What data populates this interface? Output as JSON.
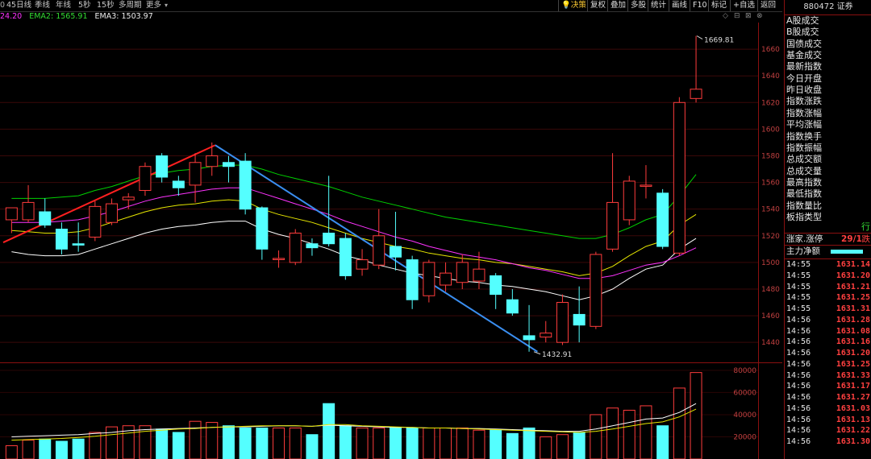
{
  "toolbar": {
    "tabs": [
      "0",
      "45日线",
      "季线",
      "年线",
      "5秒",
      "15秒",
      "多周期",
      "更多"
    ],
    "indicators": {
      "ema1": "24.20",
      "ema2": "EMA2: 1565.91",
      "ema3": "EMA3: 1503.97"
    },
    "tools": [
      "决策",
      "复权",
      "叠加",
      "多股",
      "统计",
      "画线",
      "F10",
      "标记",
      "+自选",
      "返回"
    ]
  },
  "chart": {
    "y_labels": [
      "1660",
      "1640",
      "1620",
      "1600",
      "1580",
      "1560",
      "1540",
      "1520",
      "1500",
      "1480",
      "1460",
      "1440"
    ],
    "high_label": "1669.81",
    "low_label": "1432.91",
    "vol_labels": [
      "80000",
      "60000",
      "40000",
      "20000"
    ],
    "colors": {
      "up": "#ff3c3c",
      "down": "#54ffff",
      "ma1": "#ffffff",
      "ma2": "#e6e600",
      "ma3": "#ff33ff",
      "ma4": "#00d200",
      "trend_up": "#ff2020",
      "trend_down": "#3a8ef0"
    }
  },
  "sidebar": {
    "code": "880472",
    "name": "证券",
    "menu": [
      "A股成交",
      "B股成交",
      "国债成交",
      "基金成交",
      "最新指数",
      "今日开盘",
      "昨日收盘",
      "指数涨跌",
      "指数涨幅",
      "平均涨幅",
      "指数换手",
      "指数振幅",
      "总成交额",
      "总成交量",
      "最高指数",
      "最低指数",
      "指数量比",
      "板指类型"
    ],
    "board_type_value": "行",
    "limit_label": "涨家.涨停",
    "limit_value": "29/1",
    "limit_suffix": "跌",
    "net_flow_label": "主力净额",
    "ticks": [
      {
        "time": "14:55",
        "price": "1631.14"
      },
      {
        "time": "14:55",
        "price": "1631.20"
      },
      {
        "time": "14:55",
        "price": "1631.21"
      },
      {
        "time": "14:55",
        "price": "1631.25"
      },
      {
        "time": "14:55",
        "price": "1631.31"
      },
      {
        "time": "14:56",
        "price": "1631.28"
      },
      {
        "time": "14:56",
        "price": "1631.08"
      },
      {
        "time": "14:56",
        "price": "1631.16"
      },
      {
        "time": "14:56",
        "price": "1631.20"
      },
      {
        "time": "14:56",
        "price": "1631.25"
      },
      {
        "time": "14:56",
        "price": "1631.33"
      },
      {
        "time": "14:56",
        "price": "1631.17"
      },
      {
        "time": "14:56",
        "price": "1631.27"
      },
      {
        "time": "14:56",
        "price": "1631.03"
      },
      {
        "time": "14:56",
        "price": "1631.13"
      },
      {
        "time": "14:56",
        "price": "1631.22"
      },
      {
        "time": "14:56",
        "price": "1631.30"
      }
    ]
  },
  "chart_data": {
    "type": "candlestick",
    "candles": [
      {
        "o": 1532,
        "h": 1540,
        "l": 1522,
        "c": 1541
      },
      {
        "o": 1532,
        "h": 1558,
        "l": 1530,
        "c": 1545
      },
      {
        "o": 1538,
        "h": 1548,
        "l": 1526,
        "c": 1528
      },
      {
        "o": 1525,
        "h": 1530,
        "l": 1506,
        "c": 1510
      },
      {
        "o": 1514,
        "h": 1530,
        "l": 1508,
        "c": 1513
      },
      {
        "o": 1519,
        "h": 1546,
        "l": 1516,
        "c": 1542
      },
      {
        "o": 1530,
        "h": 1548,
        "l": 1528,
        "c": 1544
      },
      {
        "o": 1547,
        "h": 1552,
        "l": 1540,
        "c": 1549
      },
      {
        "o": 1554,
        "h": 1575,
        "l": 1550,
        "c": 1572
      },
      {
        "o": 1580,
        "h": 1582,
        "l": 1560,
        "c": 1564
      },
      {
        "o": 1561,
        "h": 1565,
        "l": 1550,
        "c": 1556
      },
      {
        "o": 1558,
        "h": 1582,
        "l": 1545,
        "c": 1575
      },
      {
        "o": 1572,
        "h": 1590,
        "l": 1565,
        "c": 1580
      },
      {
        "o": 1575,
        "h": 1580,
        "l": 1560,
        "c": 1572
      },
      {
        "o": 1576,
        "h": 1582,
        "l": 1536,
        "c": 1540
      },
      {
        "o": 1541,
        "h": 1542,
        "l": 1502,
        "c": 1510
      },
      {
        "o": 1503,
        "h": 1509,
        "l": 1496,
        "c": 1503
      },
      {
        "o": 1500,
        "h": 1525,
        "l": 1498,
        "c": 1522
      },
      {
        "o": 1514,
        "h": 1518,
        "l": 1505,
        "c": 1511
      },
      {
        "o": 1522,
        "h": 1565,
        "l": 1512,
        "c": 1514
      },
      {
        "o": 1518,
        "h": 1522,
        "l": 1487,
        "c": 1490
      },
      {
        "o": 1495,
        "h": 1510,
        "l": 1490,
        "c": 1502
      },
      {
        "o": 1498,
        "h": 1540,
        "l": 1495,
        "c": 1520
      },
      {
        "o": 1512,
        "h": 1538,
        "l": 1494,
        "c": 1504
      },
      {
        "o": 1502,
        "h": 1505,
        "l": 1465,
        "c": 1472
      },
      {
        "o": 1475,
        "h": 1502,
        "l": 1470,
        "c": 1500
      },
      {
        "o": 1483,
        "h": 1500,
        "l": 1478,
        "c": 1492
      },
      {
        "o": 1485,
        "h": 1506,
        "l": 1480,
        "c": 1500
      },
      {
        "o": 1486,
        "h": 1508,
        "l": 1480,
        "c": 1495
      },
      {
        "o": 1490,
        "h": 1492,
        "l": 1465,
        "c": 1476
      },
      {
        "o": 1472,
        "h": 1480,
        "l": 1460,
        "c": 1462
      },
      {
        "o": 1445,
        "h": 1468,
        "l": 1433,
        "c": 1442
      },
      {
        "o": 1444,
        "h": 1456,
        "l": 1440,
        "c": 1447
      },
      {
        "o": 1440,
        "h": 1476,
        "l": 1438,
        "c": 1470
      },
      {
        "o": 1461,
        "h": 1482,
        "l": 1440,
        "c": 1453
      },
      {
        "o": 1452,
        "h": 1508,
        "l": 1450,
        "c": 1506
      },
      {
        "o": 1510,
        "h": 1582,
        "l": 1508,
        "c": 1545
      },
      {
        "o": 1532,
        "h": 1565,
        "l": 1528,
        "c": 1561
      },
      {
        "o": 1558,
        "h": 1573,
        "l": 1548,
        "c": 1558
      },
      {
        "o": 1552,
        "h": 1555,
        "l": 1510,
        "c": 1512
      },
      {
        "o": 1507,
        "h": 1624,
        "l": 1505,
        "c": 1620
      },
      {
        "o": 1623,
        "h": 1670,
        "l": 1620,
        "c": 1630
      }
    ],
    "volume": [
      12000,
      17000,
      18000,
      16000,
      18000,
      24000,
      29000,
      30000,
      30000,
      27000,
      24000,
      34000,
      33000,
      30000,
      28000,
      28000,
      28000,
      28000,
      22000,
      50000,
      30000,
      28000,
      28000,
      28000,
      28000,
      28000,
      28000,
      28000,
      26000,
      26000,
      23000,
      28000,
      20000,
      22000,
      24000,
      40000,
      46000,
      44000,
      48000,
      30000,
      64000,
      78000
    ],
    "y_range": [
      1425,
      1680
    ],
    "vol_range": [
      0,
      85000
    ],
    "ma_lines": [
      {
        "values": [
          1508,
          1506,
          1505,
          1505,
          1506,
          1510,
          1514,
          1518,
          1522,
          1525,
          1527,
          1528,
          1530,
          1531,
          1531,
          1525,
          1521,
          1518,
          1514,
          1510,
          1505,
          1502,
          1498,
          1495,
          1492,
          1490,
          1488,
          1486,
          1485,
          1483,
          1482,
          1480,
          1478,
          1475,
          1472,
          1475,
          1480,
          1488,
          1495,
          1498,
          1510,
          1518
        ]
      },
      {
        "values": [
          1524,
          1523,
          1522,
          1522,
          1523,
          1526,
          1530,
          1534,
          1538,
          1541,
          1543,
          1544,
          1546,
          1547,
          1546,
          1540,
          1536,
          1533,
          1530,
          1526,
          1522,
          1518,
          1515,
          1512,
          1510,
          1507,
          1505,
          1503,
          1502,
          1500,
          1499,
          1497,
          1495,
          1493,
          1490,
          1492,
          1497,
          1505,
          1512,
          1516,
          1528,
          1536
        ]
      },
      {
        "values": [
          1530,
          1530,
          1530,
          1531,
          1532,
          1535,
          1538,
          1542,
          1546,
          1549,
          1551,
          1553,
          1555,
          1556,
          1556,
          1552,
          1548,
          1544,
          1540,
          1536,
          1531,
          1527,
          1523,
          1519,
          1516,
          1512,
          1509,
          1506,
          1504,
          1502,
          1499,
          1496,
          1494,
          1491,
          1488,
          1488,
          1490,
          1494,
          1498,
          1500,
          1505,
          1511
        ]
      },
      {
        "values": [
          1548,
          1548,
          1548,
          1549,
          1550,
          1554,
          1557,
          1561,
          1565,
          1567,
          1569,
          1570,
          1572,
          1573,
          1573,
          1570,
          1566,
          1563,
          1560,
          1557,
          1553,
          1549,
          1546,
          1543,
          1540,
          1537,
          1534,
          1532,
          1530,
          1528,
          1526,
          1524,
          1522,
          1520,
          1518,
          1518,
          1521,
          1526,
          1532,
          1536,
          1550,
          1566
        ]
      }
    ],
    "vol_ma_lines": [
      {
        "values": [
          20000,
          20500,
          21000,
          21500,
          22000,
          23000,
          24000,
          25500,
          26500,
          27000,
          27500,
          28000,
          28500,
          29000,
          29000,
          29500,
          30000,
          30000,
          29500,
          30500,
          30000,
          29500,
          29000,
          28500,
          28500,
          28000,
          28000,
          27500,
          27500,
          27000,
          26500,
          26000,
          25500,
          25000,
          25000,
          27000,
          30000,
          33000,
          36000,
          37000,
          42000,
          50000
        ]
      },
      {
        "values": [
          17000,
          17500,
          18000,
          18500,
          19500,
          20500,
          22000,
          23500,
          25000,
          26000,
          27000,
          27500,
          28500,
          29000,
          29500,
          30000,
          30000,
          30000,
          29500,
          31000,
          31000,
          30000,
          29500,
          29000,
          28500,
          28000,
          28000,
          27500,
          27000,
          26500,
          26000,
          25500,
          25000,
          24500,
          24000,
          25000,
          27000,
          29500,
          32000,
          33500,
          38000,
          45000
        ]
      }
    ],
    "trend_lines": [
      {
        "from": [
          -0.5,
          1515
        ],
        "to": [
          12.2,
          1588
        ]
      },
      {
        "from": [
          12.2,
          1588
        ],
        "to": [
          31.5,
          1433
        ]
      }
    ]
  }
}
